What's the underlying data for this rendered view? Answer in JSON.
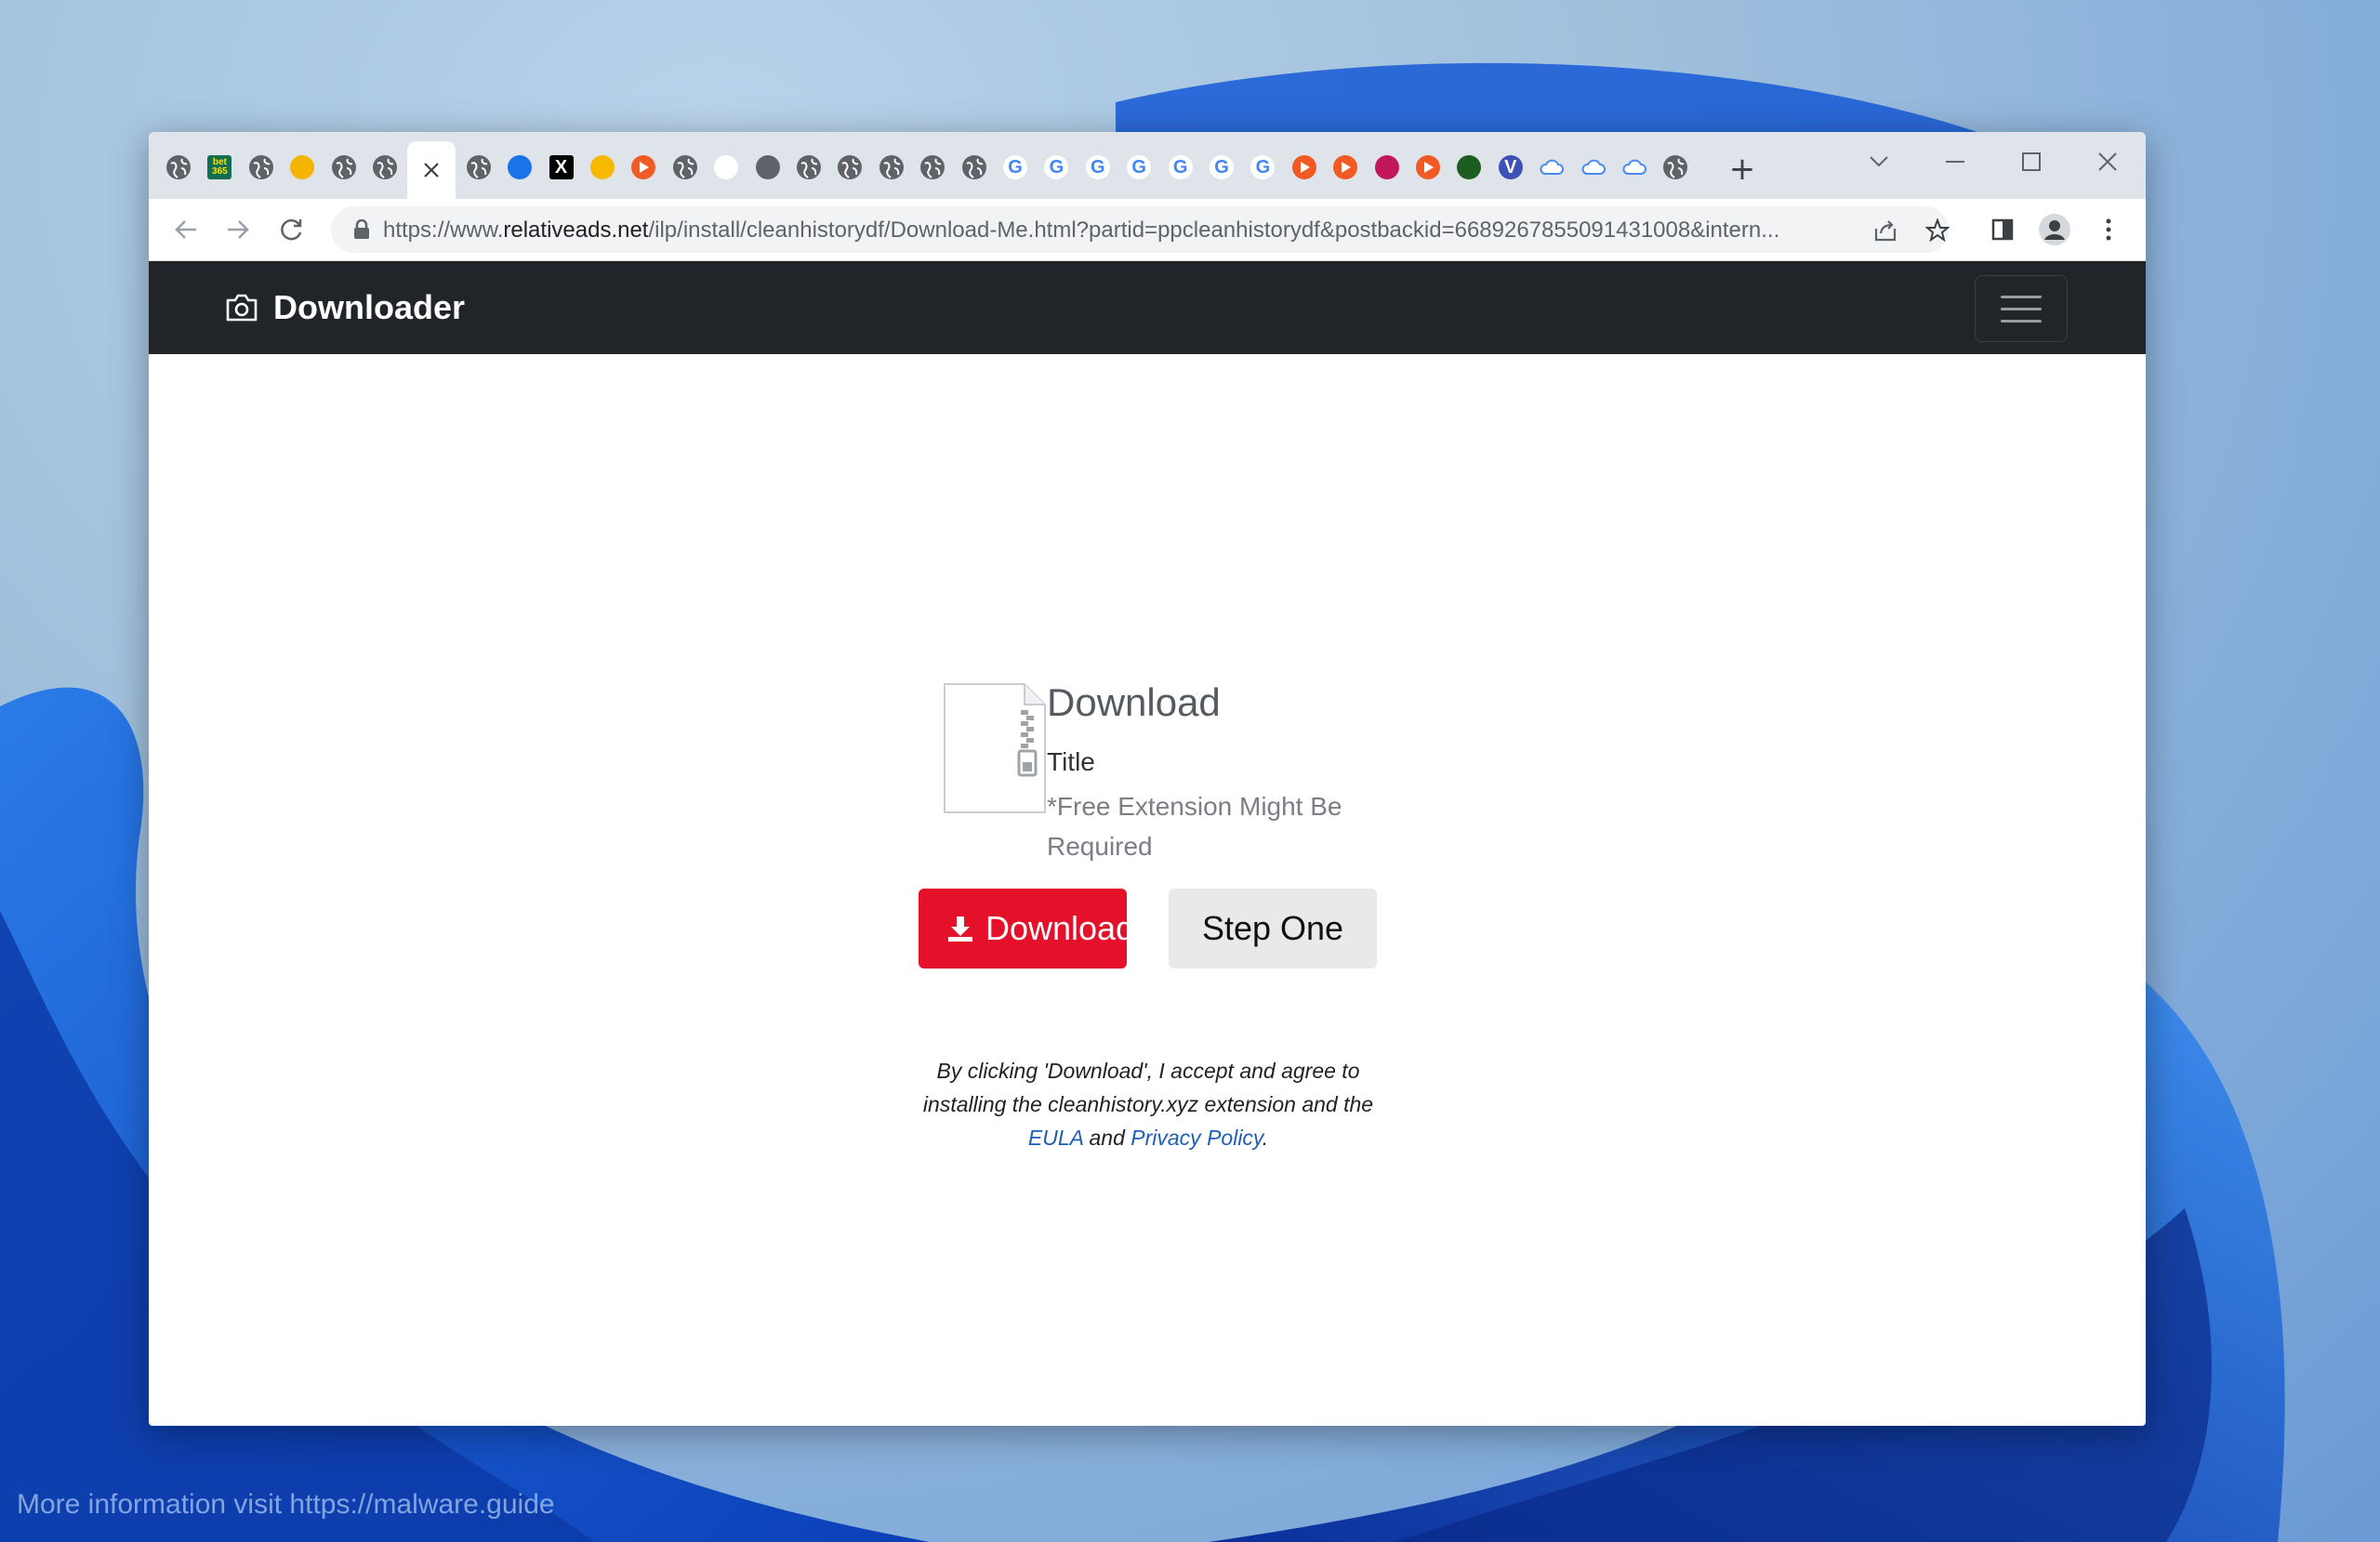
{
  "desktop": {
    "watermark": "More information visit https://malware.guide"
  },
  "browser": {
    "tabs": [
      {
        "icon": "globe-icon"
      },
      {
        "icon": "bet365-icon",
        "text": "bet 365"
      },
      {
        "icon": "globe-icon"
      },
      {
        "icon": "bee-icon"
      },
      {
        "icon": "globe-icon"
      },
      {
        "icon": "globe-icon"
      },
      {
        "icon": "close-icon",
        "active": true
      },
      {
        "icon": "globe-icon"
      },
      {
        "icon": "puzzle-icon"
      },
      {
        "icon": "x-icon",
        "text": "X"
      },
      {
        "icon": "notification-icon"
      },
      {
        "icon": "play-icon"
      },
      {
        "icon": "globe-icon"
      },
      {
        "icon": "leaf-icon"
      },
      {
        "icon": "robot-icon"
      },
      {
        "icon": "globe-icon"
      },
      {
        "icon": "globe-icon"
      },
      {
        "icon": "globe-icon"
      },
      {
        "icon": "globe-icon"
      },
      {
        "icon": "globe-icon"
      },
      {
        "icon": "google-icon",
        "text": "G"
      },
      {
        "icon": "google-icon",
        "text": "G"
      },
      {
        "icon": "google-icon",
        "text": "G"
      },
      {
        "icon": "google-icon",
        "text": "G"
      },
      {
        "icon": "google-icon",
        "text": "G"
      },
      {
        "icon": "google-icon",
        "text": "G"
      },
      {
        "icon": "google-icon",
        "text": "G"
      },
      {
        "icon": "play-icon"
      },
      {
        "icon": "play-icon"
      },
      {
        "icon": "avatar-icon"
      },
      {
        "icon": "play-icon"
      },
      {
        "icon": "shield-icon"
      },
      {
        "icon": "v-icon",
        "text": "V"
      },
      {
        "icon": "cloud-icon"
      },
      {
        "icon": "cloud-icon"
      },
      {
        "icon": "cloud-icon"
      },
      {
        "icon": "globe-icon"
      }
    ],
    "new_tab_label": "+",
    "url_prefix": "https://www.",
    "url_domain": "relativeads.net",
    "url_rest": "/ilp/install/cleanhistorydf/Download-Me.html?partid=ppcleanhistorydf&postbackid=6689267855091431008&intern..."
  },
  "page": {
    "brand": "Downloader",
    "download_heading": "Download",
    "file_title": "Title",
    "note": "*Free Extension Might Be Required",
    "download_button": "Download",
    "step_button": "Step One",
    "terms_text": "By clicking 'Download', I accept and agree to installing the cleanhistory.xyz extension and the",
    "eula_link": "EULA",
    "and_text": "and",
    "privacy_link": "Privacy Policy",
    "period": "."
  },
  "colors": {
    "navbar": "#212529",
    "download_button": "#e5112b",
    "step_button": "#e9e9ea",
    "link": "#1f5fb5"
  }
}
